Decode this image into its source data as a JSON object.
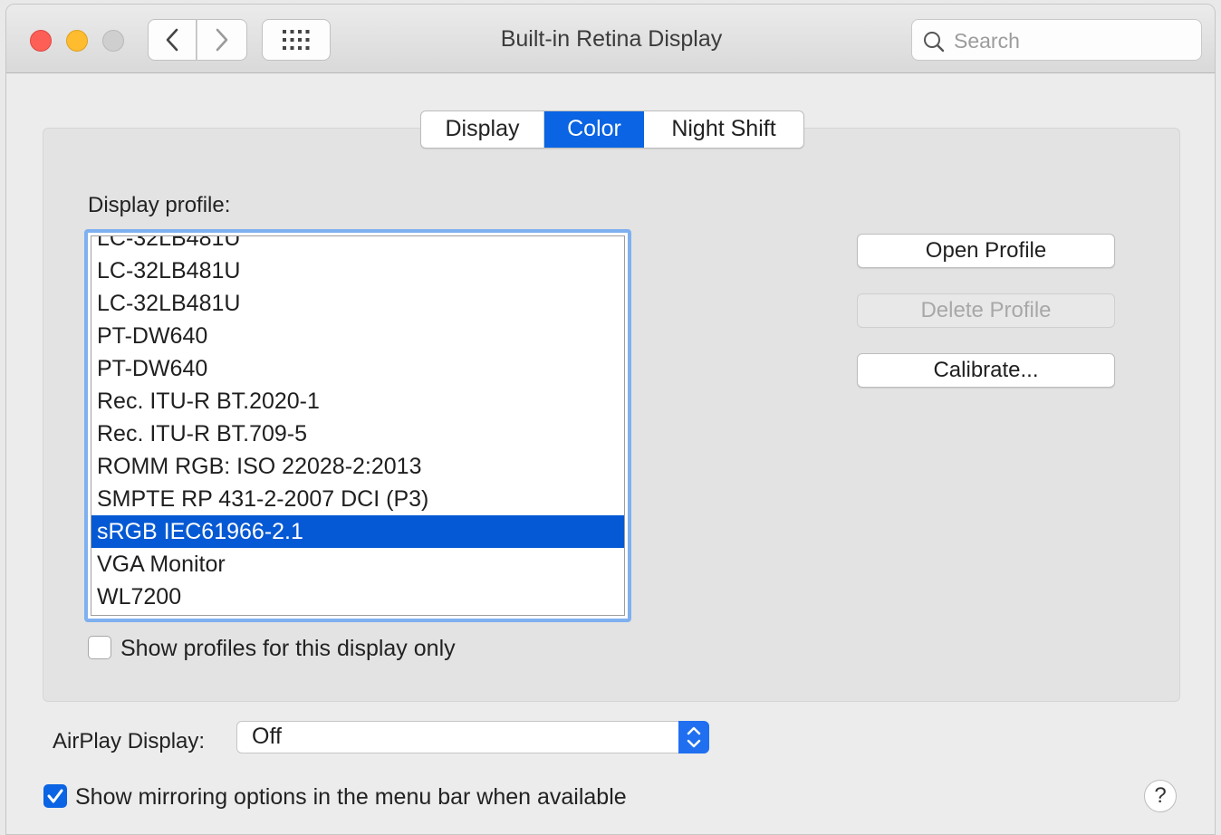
{
  "window": {
    "title": "Built-in Retina Display"
  },
  "search": {
    "placeholder": "Search"
  },
  "tabs": [
    {
      "label": "Display"
    },
    {
      "label": "Color",
      "selected": true
    },
    {
      "label": "Night Shift"
    }
  ],
  "profile": {
    "label": "Display profile:",
    "items": [
      "LC-32LB481U",
      "LC-32LB481U",
      "LC-32LB481U",
      "PT-DW640",
      "PT-DW640",
      "Rec. ITU-R BT.2020-1",
      "Rec. ITU-R BT.709-5",
      "ROMM RGB: ISO 22028-2:2013",
      "SMPTE RP 431-2-2007 DCI (P3)",
      "sRGB IEC61966-2.1",
      "VGA Monitor",
      "WL7200"
    ],
    "selected_item": "sRGB IEC61966-2.1",
    "show_only_label": "Show profiles for this display only"
  },
  "buttons": {
    "open": "Open Profile",
    "delete": "Delete Profile",
    "calibrate": "Calibrate..."
  },
  "airplay": {
    "label": "AirPlay Display:",
    "value": "Off"
  },
  "mirroring": {
    "label": "Show mirroring options in the menu bar when available",
    "checked": true
  },
  "help": {
    "label": "?"
  },
  "colors": {
    "accent": "#0a64e3",
    "selection": "#0659d4",
    "focus_ring": "#7fb0f0"
  }
}
